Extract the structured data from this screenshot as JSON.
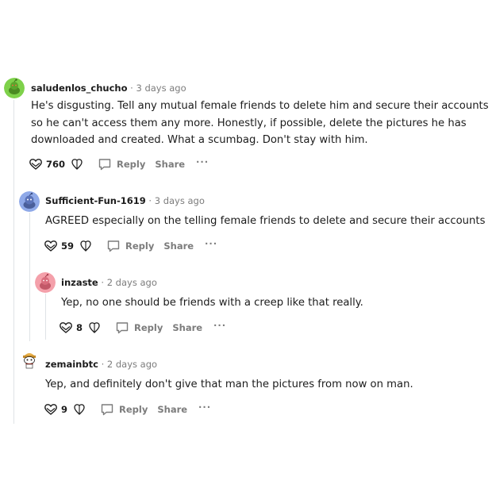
{
  "labels": {
    "reply": "Reply",
    "share": "Share",
    "more": "···"
  },
  "comments": [
    {
      "username": "saludenlos_chucho",
      "separator": "·",
      "time": "3 days ago",
      "avatar": "green-snoo-avatar",
      "avatar_color": "#7ed14a",
      "body": "He's disgusting. Tell any mutual female friends to delete him and secure their accounts so he can't access them any more. Honestly, if possible, delete the pictures he has downloaded and created. What a scumbag. Don't stay with him.",
      "score": "760"
    },
    {
      "username": "Sufficient-Fun-1619",
      "separator": "·",
      "time": "3 days ago",
      "avatar": "blue-snoo-avatar",
      "avatar_color": "#8fa9e8",
      "body": "AGREED especially on the telling female friends to delete and secure their accounts",
      "score": "59"
    },
    {
      "username": "inzaste",
      "separator": "·",
      "time": "2 days ago",
      "avatar": "pink-snoo-avatar",
      "avatar_color": "#f4a0aa",
      "body": "Yep, no one should be friends with a creep like that really.",
      "score": "8"
    },
    {
      "username": "zemainbtc",
      "separator": "·",
      "time": "2 days ago",
      "avatar": "custom-snoo-avatar",
      "avatar_color": "#e8b04a",
      "body": "Yep, and definitely don't give that man the pictures from now on man.",
      "score": "9"
    }
  ]
}
